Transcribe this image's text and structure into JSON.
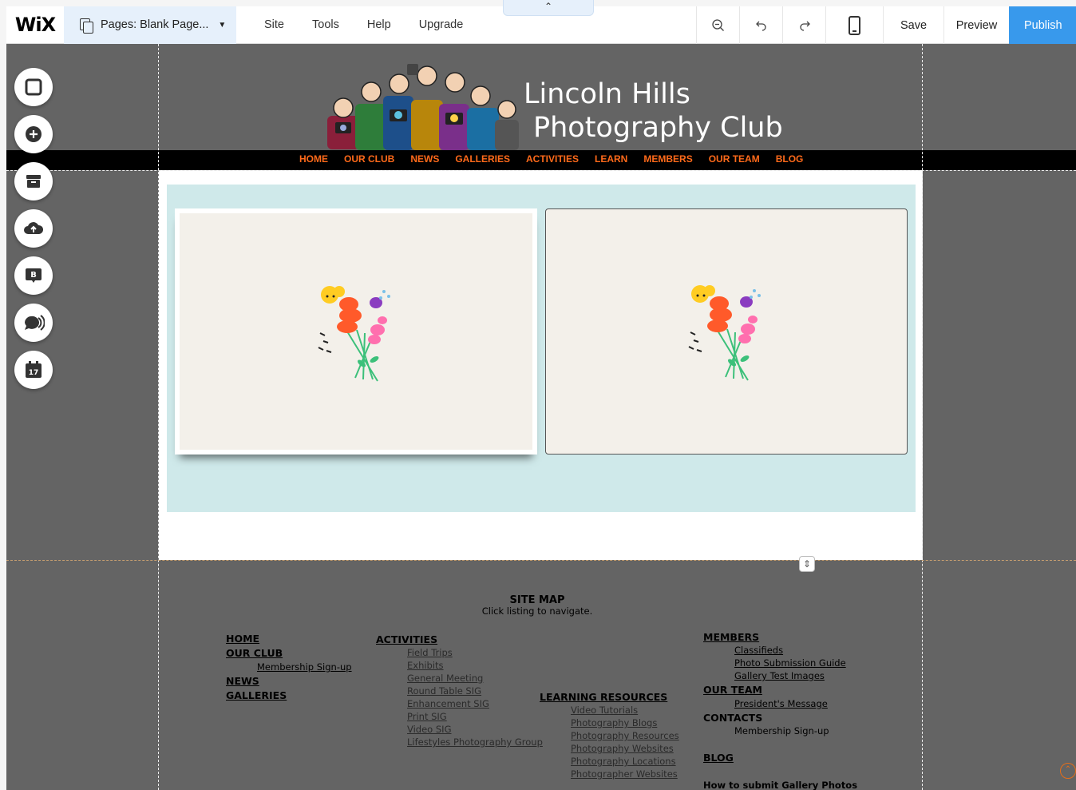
{
  "topbar": {
    "logo": "WiX",
    "pages_label": "Pages: Blank Page...",
    "menu": [
      "Site",
      "Tools",
      "Help",
      "Upgrade"
    ],
    "save": "Save",
    "preview": "Preview",
    "publish": "Publish"
  },
  "site": {
    "title_line1": "Lincoln Hills",
    "title_line2": "Photography Club",
    "nav": [
      "HOME",
      "OUR CLUB",
      "NEWS",
      "GALLERIES",
      "ACTIVITIES",
      "LEARN",
      "MEMBERS",
      "OUR TEAM",
      "BLOG"
    ]
  },
  "sitemap": {
    "title": "SITE MAP",
    "subtitle": "Click listing to navigate.",
    "col1": {
      "home": "HOME",
      "our_club": "OUR CLUB",
      "membership": "Membership Sign-up",
      "news": "NEWS",
      "galleries": "GALLERIES"
    },
    "col2": {
      "activities": "ACTIVITIES",
      "items": [
        "Field Trips",
        "Exhibits",
        "General Meeting",
        "Round Table SIG",
        "Enhancement SIG",
        "Print SIG",
        "Video SIG",
        "Lifestyles Photography Group"
      ]
    },
    "col3": {
      "learning": "LEARNING RESOURCES",
      "items": [
        "Video Tutorials",
        "Photography Blogs",
        "Photography Resources",
        "Photography Websites",
        "Photography Locations",
        "Photographer Websites"
      ]
    },
    "col4": {
      "members": "MEMBERS",
      "member_items": [
        "Classifieds",
        "Photo Submission Guide",
        "Gallery Test Images"
      ],
      "our_team": "OUR TEAM",
      "president": "President's Message",
      "contacts": "CONTACTS",
      "membership": "Membership Sign-up",
      "blog": "BLOG",
      "how_to": "How to submit Gallery Photos"
    }
  },
  "colors": {
    "publish_blue": "#3899ec",
    "nav_orange": "#ff6a1a",
    "canvas_gray": "#646464",
    "strip_cyan": "#cfe9ea"
  }
}
